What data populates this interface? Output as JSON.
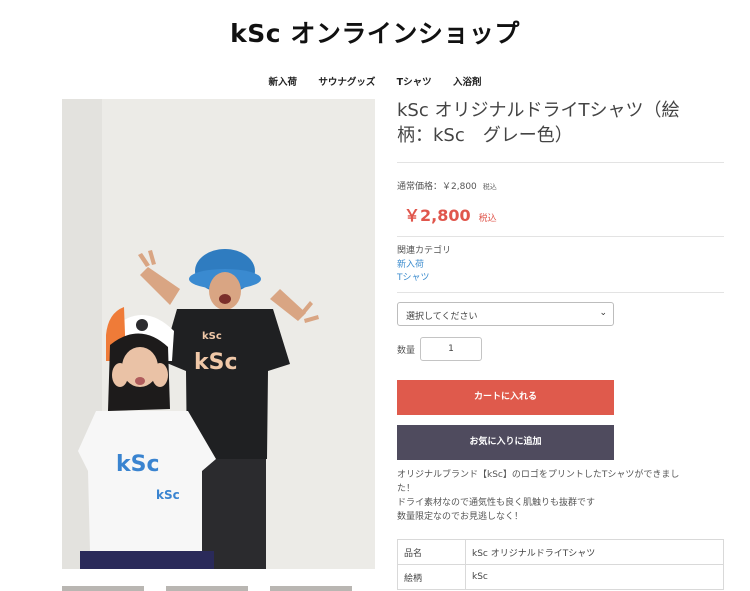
{
  "site": {
    "title": "kSc オンラインショップ"
  },
  "nav": {
    "items": [
      "新入荷",
      "サウナグッズ",
      "Tシャツ",
      "入浴剤"
    ]
  },
  "photo": {
    "print_text": [
      "kSc",
      "kSc",
      "kSc",
      "kSc"
    ]
  },
  "product": {
    "title_line1": "kSc オリジナルドライTシャツ（絵",
    "title_line2": "柄：kSc　グレー色）",
    "regular_price_label": "通常価格：￥2,800",
    "regular_price_tax": "税込",
    "sale_price": "￥2,800",
    "sale_price_tax": "税込",
    "related_label": "関連カテゴリ",
    "related_links": [
      "新入荷",
      "Tシャツ"
    ],
    "select_placeholder": "選択してください",
    "quantity_label": "数量",
    "quantity_value": "1",
    "add_to_cart": "カートに入れる",
    "add_to_favorites": "お気に入りに追加",
    "description": [
      "オリジナルブランド【kSc】のロゴをプリントしたTシャツができまし",
      "た！",
      "ドライ素材なので通気性も良く肌触りも抜群です",
      "数量限定なのでお見逃しなく！"
    ],
    "spec": [
      {
        "key": "品名",
        "value": "kSc オリジナルドライTシャツ"
      },
      {
        "key": "絵柄",
        "value": "kSc"
      }
    ]
  },
  "colors": {
    "accent_red": "#df5a4c",
    "fav_button": "#4f4b5e",
    "link_blue": "#3f8ecf"
  }
}
